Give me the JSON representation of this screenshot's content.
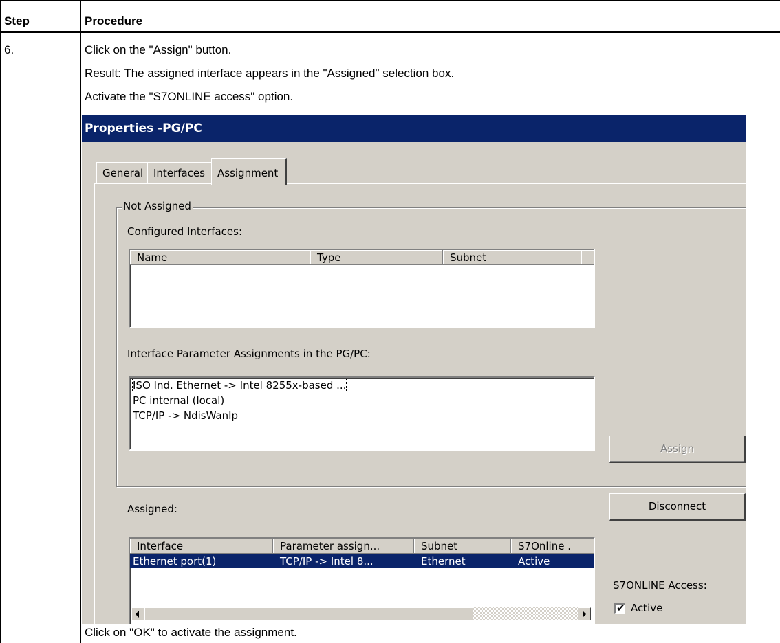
{
  "table": {
    "header_step": "Step",
    "header_procedure": "Procedure",
    "step_number": "6.",
    "lines": [
      "Click on the \"Assign\" button.",
      "Result: The assigned interface appears in the \"Assigned\" selection box.",
      "Activate the \"S7ONLINE access\" option."
    ],
    "footer_line": "Click on \"OK\" to activate the assignment."
  },
  "dialog": {
    "title": "Properties -PG/PC",
    "tabs": [
      {
        "label": "General",
        "active": false
      },
      {
        "label": "Interfaces",
        "active": false
      },
      {
        "label": "Assignment",
        "active": true
      }
    ],
    "not_assigned_group": "Not Assigned",
    "configured_label": "Configured Interfaces:",
    "configured_columns": [
      "Name",
      "Type",
      "Subnet"
    ],
    "param_label": "Interface Parameter Assignments in the PG/PC:",
    "param_items": [
      "ISO Ind. Ethernet -> Intel 8255x-based ...",
      "PC internal (local)",
      "TCP/IP -> NdisWanIp"
    ],
    "assign_button": "Assign",
    "assigned_label": "Assigned:",
    "disconnect_button": "Disconnect",
    "assigned_columns": [
      "Interface",
      "Parameter assign...",
      "Subnet",
      "S7Online ."
    ],
    "assigned_rows": [
      {
        "interface": "Ethernet port(1)",
        "parameter": "TCP/IP -> Intel 8...",
        "subnet": "Ethernet",
        "s7online": "Active",
        "selected": true
      }
    ],
    "s7online_label": "S7ONLINE Access:",
    "active_checkbox": {
      "label": "Active",
      "checked": true
    }
  },
  "colors": {
    "dialog_bg": "#d4d0c8",
    "titlebar": "#0a246a",
    "selection": "#0a246a"
  }
}
